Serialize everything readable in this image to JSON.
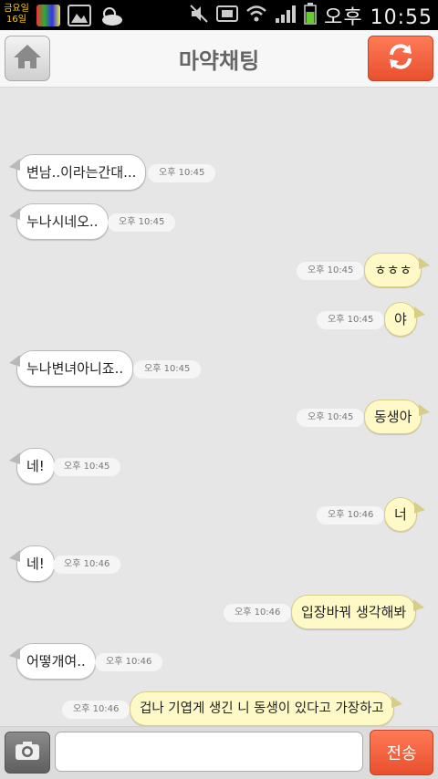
{
  "status_bar": {
    "date_weekday": "금요일",
    "date_day": "16일",
    "time": "오후 10:55",
    "icons": [
      "calendar-icon",
      "app-icon",
      "gallery-icon",
      "weather-icon",
      "mute-icon",
      "sync-icon",
      "wifi-icon",
      "signal-icon",
      "battery-icon"
    ]
  },
  "header": {
    "title": "마약채팅",
    "home_icon": "home-icon",
    "refresh_icon": "refresh-icon"
  },
  "messages": [
    {
      "side": "in",
      "text": "변남..이라는간대...",
      "time": "오후 10:45"
    },
    {
      "side": "in",
      "text": "누나시네오..",
      "time": "오후 10:45"
    },
    {
      "side": "out",
      "text": "ㅎㅎㅎ",
      "time": "오후 10:45"
    },
    {
      "side": "out",
      "text": "야",
      "time": "오후 10:45"
    },
    {
      "side": "in",
      "text": "누나변녀아니죠..",
      "time": "오후 10:45"
    },
    {
      "side": "out",
      "text": "동생아",
      "time": "오후 10:45"
    },
    {
      "side": "in",
      "text": "네!",
      "time": "오후 10:45"
    },
    {
      "side": "out",
      "text": "너",
      "time": "오후 10:46"
    },
    {
      "side": "in",
      "text": "네!",
      "time": "오후 10:46"
    },
    {
      "side": "out",
      "text": "입장바꿔 생각해봐",
      "time": "오후 10:46"
    },
    {
      "side": "in",
      "text": "어떻개여..",
      "time": "오후 10:46"
    },
    {
      "side": "out",
      "text": "겁나 기엽게 생긴 니 동생이 있다고 가장하고",
      "time": "오후 10:46"
    }
  ],
  "composer": {
    "camera_icon": "camera-icon",
    "input_value": "",
    "input_placeholder": "",
    "send_label": "전송"
  },
  "colors": {
    "accent": "#f05a38",
    "incoming_bubble": "#ffffff",
    "outgoing_bubble": "#fff9c8",
    "background": "#e6e6e6"
  }
}
